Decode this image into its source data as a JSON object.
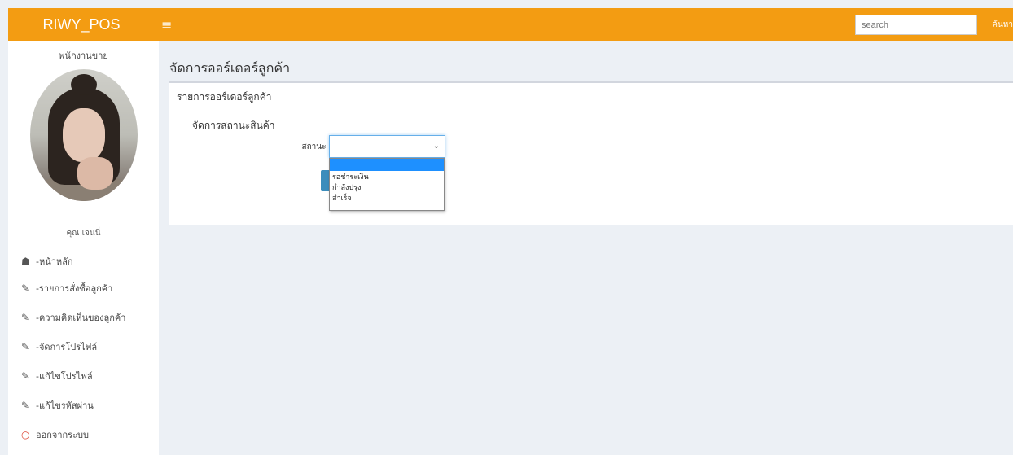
{
  "header": {
    "brand": "RIWY_POS",
    "menu_icon": "≡",
    "search_placeholder": "search",
    "search_button": "ค้นหา",
    "accent": "#f39c12"
  },
  "sidebar": {
    "role": "พนักงานขาย",
    "username": "คุณ เจนนี่",
    "items": [
      {
        "icon": "home-icon",
        "glyph": "☗",
        "label": "-หน้าหลัก"
      },
      {
        "icon": "edit-icon",
        "glyph": "✎",
        "label": "-รายการสั่งซื้อลูกค้า"
      },
      {
        "icon": "edit-icon",
        "glyph": "✎",
        "label": "-ความคิดเห็นของลูกค้า"
      },
      {
        "icon": "edit-icon",
        "glyph": "✎",
        "label": "-จัดการโปรไฟล์"
      },
      {
        "icon": "edit-icon",
        "glyph": "✎",
        "label": "-แก้ไขโปรไฟล์"
      },
      {
        "icon": "edit-icon",
        "glyph": "✎",
        "label": "-แก้ไขรหัสผ่าน"
      },
      {
        "icon": "logout-icon",
        "glyph": "○",
        "label": "ออกจากระบบ"
      }
    ]
  },
  "main": {
    "page_title": "จัดการออร์เดอร์ลูกค้า",
    "box_title": "รายการออร์เดอร์ลูกค้า",
    "section_title": "จัดการสถานะสินค้า",
    "status_label": "สถานะ :",
    "status_value": "",
    "status_options": [
      "",
      "รอชำระเงิน",
      "กำลังปรุง",
      "สำเร็จ"
    ]
  }
}
